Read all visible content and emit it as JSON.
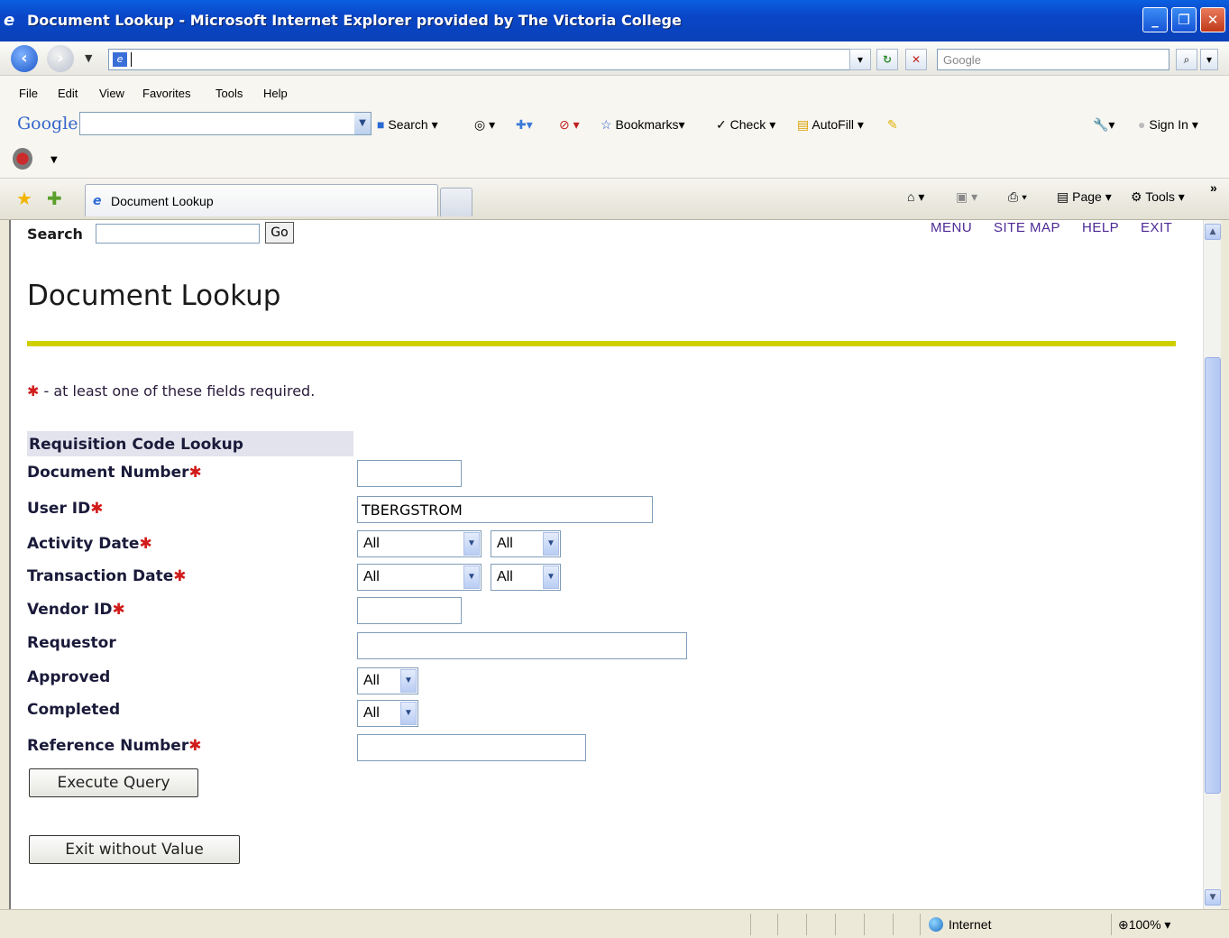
{
  "window": {
    "title": "Document Lookup - Microsoft Internet Explorer provided by The Victoria College"
  },
  "address": {
    "value": ""
  },
  "google_toolbar": {
    "search_placeholder": "Google",
    "search_label": "Search",
    "bookmarks_label": "Bookmarks",
    "check_label": "Check",
    "autofill_label": "AutoFill",
    "signin_label": "Sign In"
  },
  "menu": {
    "items": [
      "File",
      "Edit",
      "View",
      "Favorites",
      "Tools",
      "Help"
    ]
  },
  "tab": {
    "label": "Document Lookup"
  },
  "command_bar": {
    "page_label": "Page",
    "tools_label": "Tools"
  },
  "status": {
    "zone": "Internet",
    "zoom": "100%"
  },
  "page": {
    "search_label": "Search",
    "go_label": "Go",
    "top_links": [
      "MENU",
      "SITE MAP",
      "HELP",
      "EXIT"
    ],
    "title": "Document Lookup",
    "required_note": "- at least one of these fields required.",
    "section_title": "Requisition Code Lookup",
    "fields": {
      "document_number": {
        "label": "Document Number",
        "value": ""
      },
      "user_id": {
        "label": "User ID",
        "value": "TBERGSTROM"
      },
      "activity_date": {
        "label": "Activity Date",
        "value1": "All",
        "value2": "All"
      },
      "transaction_date": {
        "label": "Transaction Date",
        "value1": "All",
        "value2": "All"
      },
      "vendor_id": {
        "label": "Vendor ID",
        "value": ""
      },
      "requestor": {
        "label": "Requestor",
        "value": ""
      },
      "approved": {
        "label": "Approved",
        "value": "All"
      },
      "completed": {
        "label": "Completed",
        "value": "All"
      },
      "reference_number": {
        "label": "Reference Number",
        "value": ""
      }
    },
    "execute_label": "Execute Query",
    "exit_label": "Exit without Value"
  },
  "colors": {
    "title_bar": "#0946c7",
    "rule": "#cfcf00",
    "link": "#4e2a96",
    "required": "#d11b1b"
  }
}
